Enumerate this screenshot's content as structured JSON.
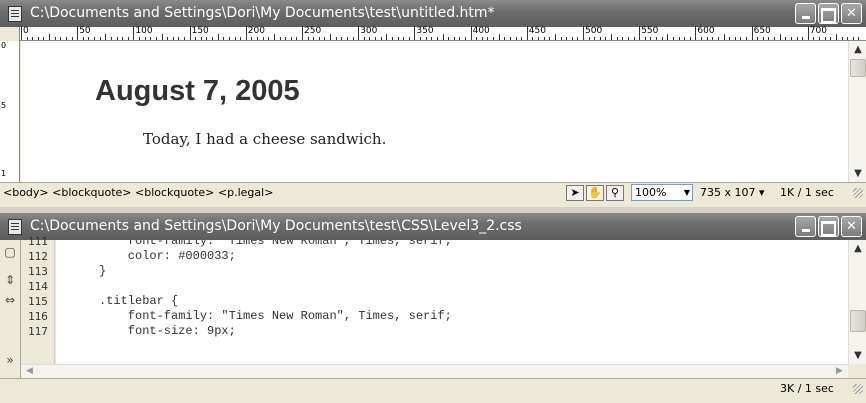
{
  "design_window": {
    "title": "C:\\Documents and Settings\\Dori\\My Documents\\test\\untitled.htm*",
    "ruler_labels": [
      "0",
      "50",
      "100",
      "150",
      "200",
      "250",
      "300",
      "350",
      "400",
      "450",
      "500",
      "550",
      "600",
      "650",
      "700"
    ],
    "vruler_labels": [
      "0",
      "5",
      "1"
    ],
    "heading": "August 7, 2005",
    "paragraph": "Today, I had a cheese sandwich.",
    "tag_selector": "<body> <blockquote> <blockquote> <p.legal>",
    "zoom": "100%",
    "dimensions": "735 x 107",
    "download_size": "1K / 1 sec"
  },
  "code_window": {
    "title": "C:\\Documents and Settings\\Dori\\My Documents\\test\\CSS\\Level3_2.css",
    "lines": [
      {
        "num": "111",
        "text": "    font-family: \"Times New Roman\", Times, serif;"
      },
      {
        "num": "112",
        "text": "    color: #000033;"
      },
      {
        "num": "113",
        "text": "}"
      },
      {
        "num": "114",
        "text": ""
      },
      {
        "num": "115",
        "text": ".titlebar {"
      },
      {
        "num": "116",
        "text": "    font-family: \"Times New Roman\", Times, serif;"
      },
      {
        "num": "117",
        "text": "    font-size: 9px;"
      }
    ],
    "download_size": "3K / 1 sec"
  },
  "window_controls": {
    "minimize": "",
    "maximize": "",
    "close": "✕"
  },
  "icons": {
    "document": "document-icon",
    "pointer": "pointer-tool-icon",
    "hand": "hand-tool-icon",
    "zoom": "zoom-tool-icon",
    "scroll_up": "scroll-up-arrow-icon",
    "scroll_down": "scroll-down-arrow-icon"
  }
}
